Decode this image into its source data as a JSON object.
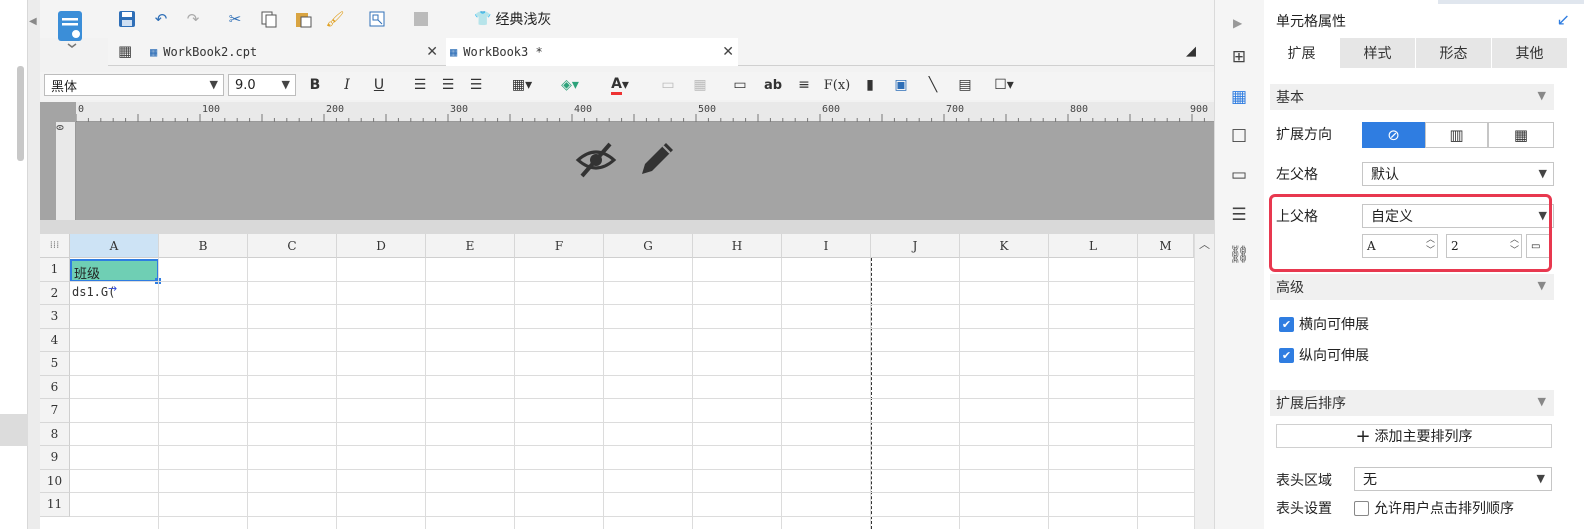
{
  "toolbar": {
    "theme_label": "经典浅灰",
    "icons": [
      "save-icon",
      "undo-icon",
      "redo-icon",
      "cut-icon",
      "copy-icon",
      "paste-icon",
      "format-painter-icon",
      "preview-icon",
      "disabled-icon"
    ]
  },
  "tabs": [
    {
      "label": "WorkBook2.cpt"
    },
    {
      "label": "WorkBook3 *"
    }
  ],
  "format": {
    "font_name": "黑体",
    "font_size": "9.0",
    "bold": "B",
    "italic": "I",
    "underline": "U",
    "text_ab": "ab",
    "fx": "F(x)"
  },
  "ruler": {
    "h_ticks": [
      "0",
      "100",
      "200",
      "300",
      "400",
      "500",
      "600",
      "700",
      "800",
      "900"
    ],
    "v_tick": "0"
  },
  "sheet": {
    "columns": [
      "A",
      "B",
      "C",
      "D",
      "E",
      "F",
      "G",
      "H",
      "I",
      "J",
      "K",
      "L",
      "M"
    ],
    "rows": [
      "1",
      "2",
      "3",
      "4",
      "5",
      "6",
      "7",
      "8",
      "9",
      "10",
      "11"
    ],
    "cells": {
      "A1": "班级",
      "A2": "ds1.G("
    }
  },
  "panel": {
    "title": "单元格属性",
    "tabs": [
      "扩展",
      "样式",
      "形态",
      "其他"
    ],
    "sections": {
      "basic": "基本",
      "advanced": "高级",
      "sort": "扩展后排序"
    },
    "labels": {
      "expand_dir": "扩展方向",
      "left_parent": "左父格",
      "up_parent": "上父格",
      "header_area": "表头区域",
      "header_setting": "表头设置"
    },
    "values": {
      "left_parent": "默认",
      "up_parent": "自定义",
      "up_col": "A",
      "up_row": "2",
      "header_area": "无"
    },
    "checkboxes": [
      {
        "label": "横向可伸展",
        "checked": true
      },
      {
        "label": "纵向可伸展",
        "checked": true
      }
    ],
    "allow_sort_label": "允许用户点击排列顺序",
    "add_sort_label": "添加主要排列序"
  },
  "colors": {
    "accent": "#2f7de1",
    "highlight_box": "#e8384f",
    "selected_cell": "#6fcfb4"
  }
}
